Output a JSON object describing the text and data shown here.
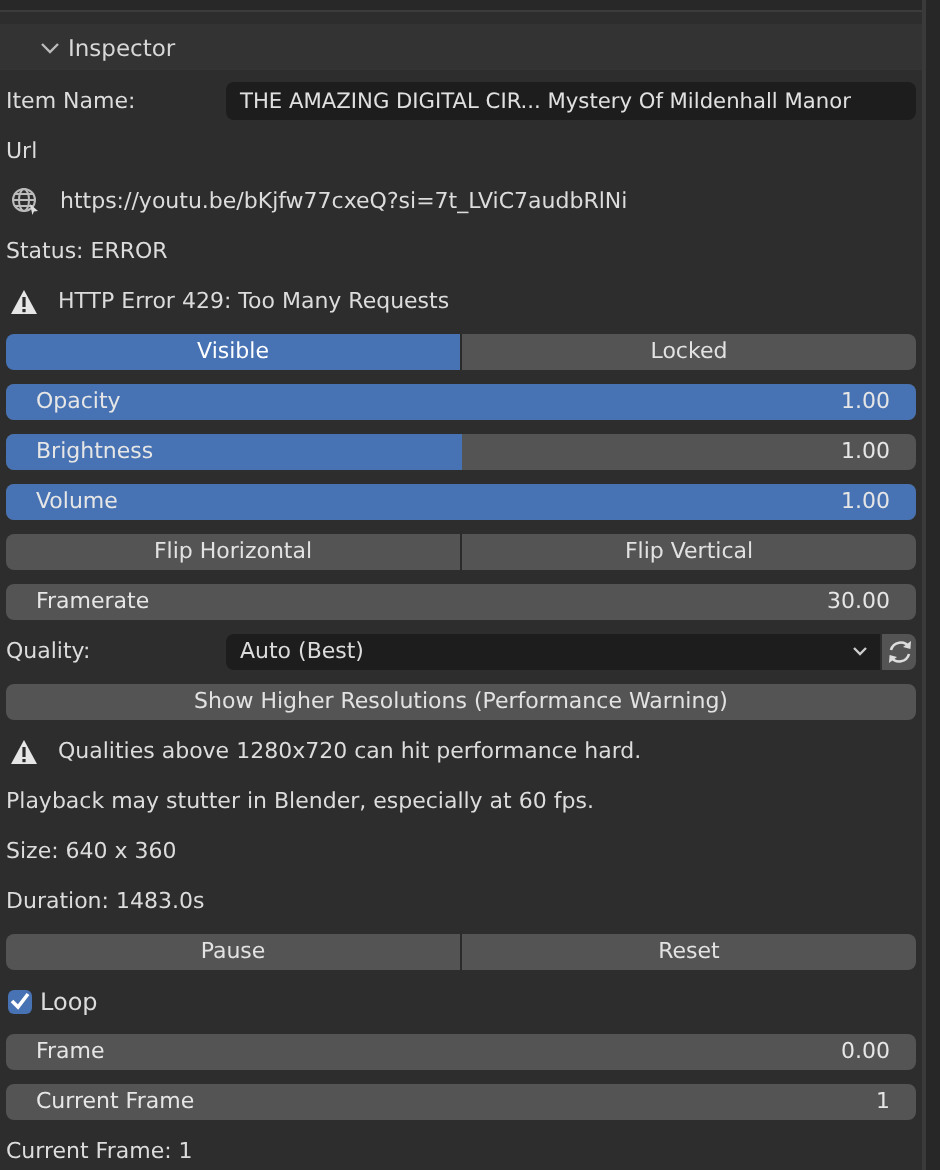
{
  "panel": {
    "title": "Inspector",
    "expanded": true
  },
  "rows": [
    {
      "kind": "field",
      "label": "Item Name:",
      "value": "THE AMAZING DIGITAL CIR... Mystery Of Mildenhall Manor"
    },
    {
      "kind": "text",
      "text": "Url"
    },
    {
      "kind": "link",
      "text": "https://youtu.be/bKjfw77cxeQ?si=7t_LViC7audbRlNi"
    },
    {
      "kind": "text",
      "text": "Status: ERROR"
    },
    {
      "kind": "alert",
      "text": "HTTP Error 429: Too Many Requests"
    },
    {
      "kind": "toggles",
      "items": [
        {
          "label": "Visible",
          "selected": true
        },
        {
          "label": "Locked",
          "selected": false
        }
      ]
    },
    {
      "kind": "slider",
      "label": "Opacity",
      "reading": "1.00",
      "level": 1
    },
    {
      "kind": "slider",
      "label": "Brightness",
      "reading": "1.00",
      "level": 0.5
    },
    {
      "kind": "slider",
      "label": "Volume",
      "reading": "1.00",
      "level": 1
    },
    {
      "kind": "buttons",
      "items": [
        "Flip Horizontal",
        "Flip Vertical"
      ]
    },
    {
      "kind": "number",
      "label": "Framerate",
      "reading": "30.00"
    },
    {
      "kind": "select",
      "label": "Quality:",
      "value": "Auto (Best)"
    },
    {
      "kind": "buttons",
      "items": [
        "Show Higher Resolutions (Performance Warning)"
      ]
    },
    {
      "kind": "alert",
      "text": "Qualities above 1280x720 can hit performance hard."
    },
    {
      "kind": "text",
      "text": "Playback may stutter in Blender, especially at 60 fps."
    },
    {
      "kind": "text",
      "text": "Size: 640 x 360"
    },
    {
      "kind": "text",
      "text": "Duration: 1483.0s"
    },
    {
      "kind": "buttons",
      "items": [
        "Pause",
        "Reset"
      ]
    },
    {
      "kind": "checkbox",
      "label": "Loop",
      "checked": true
    },
    {
      "kind": "number",
      "label": "Frame",
      "reading": "0.00"
    },
    {
      "kind": "number",
      "label": "Current Frame",
      "reading": "1"
    },
    {
      "kind": "text",
      "text": "Current Frame: 1"
    }
  ]
}
